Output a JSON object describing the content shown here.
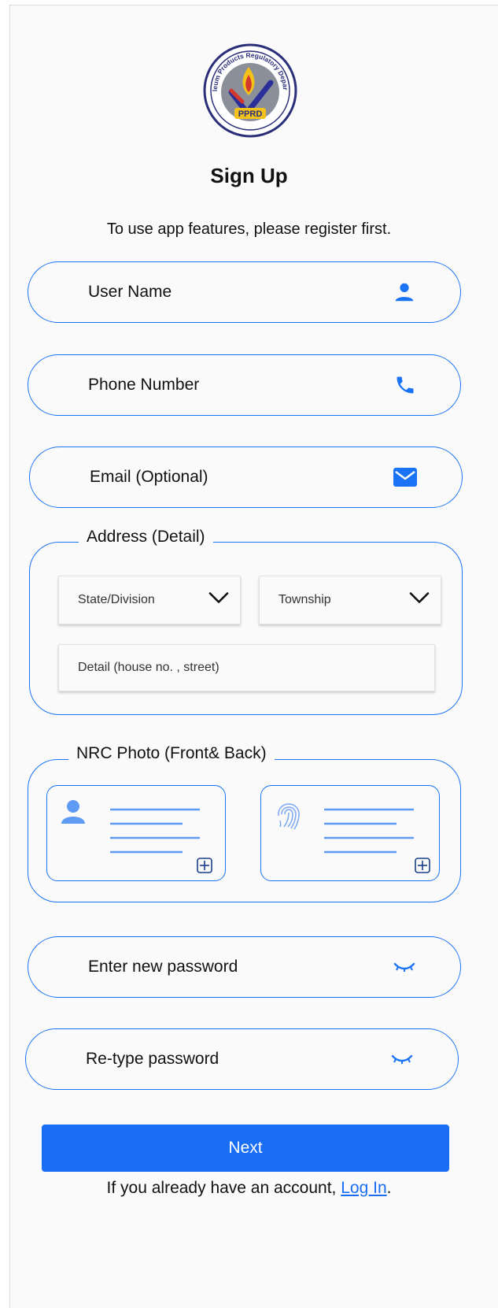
{
  "header": {
    "logo_text": "Petroleum Products Regulatory Department",
    "logo_abbr": "PPRD",
    "title": "Sign Up",
    "subtitle": "To use app features, please register first."
  },
  "fields": {
    "username": {
      "label": "User Name",
      "icon": "user-icon"
    },
    "phone": {
      "label": "Phone Number",
      "icon": "phone-icon"
    },
    "email": {
      "label": "Email (Optional)",
      "icon": "mail-icon"
    }
  },
  "address": {
    "legend": "Address (Detail)",
    "state_placeholder": "State/Division",
    "township_placeholder": "Township",
    "detail_placeholder": "Detail (house no. , street)"
  },
  "nrc": {
    "legend": "NRC Photo (Front& Back)"
  },
  "password": {
    "new_label": "Enter new password",
    "retype_label": "Re-type password",
    "icon": "eye-closed-icon"
  },
  "actions": {
    "next_label": "Next",
    "footer_prefix": "If you already have an account, ",
    "login_label": "Log In",
    "footer_suffix": "."
  },
  "colors": {
    "accent": "#1a73f5",
    "button": "#1a6ef5",
    "card_icon": "#5f9af5"
  }
}
